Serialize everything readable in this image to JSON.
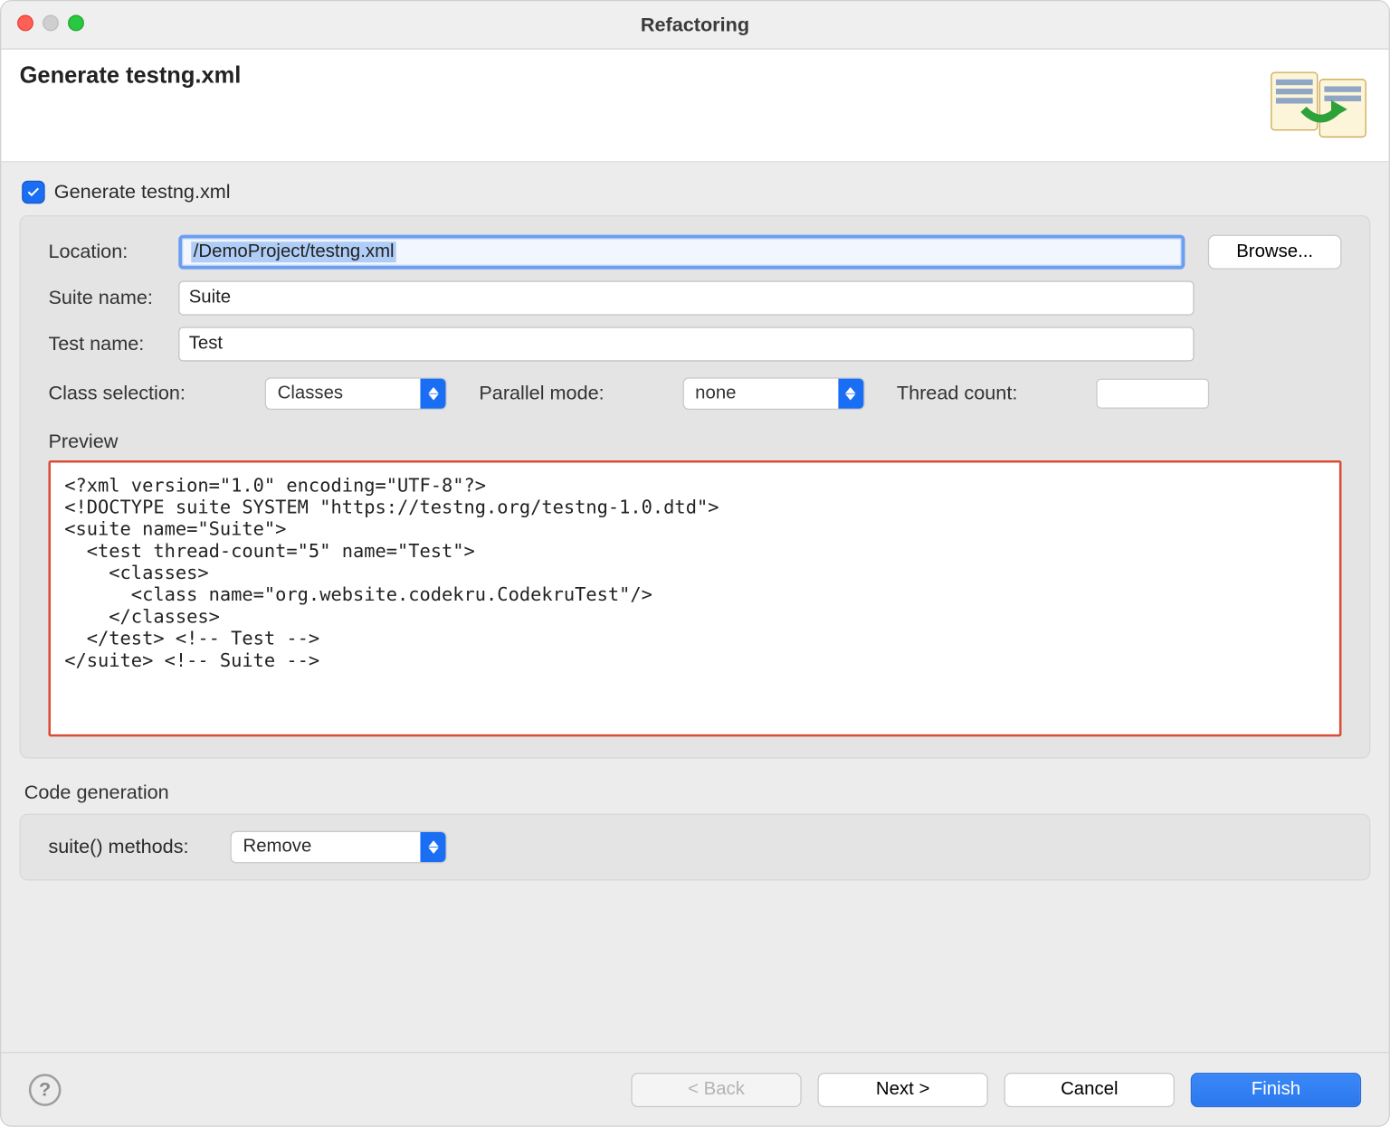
{
  "titlebar": {
    "title": "Refactoring"
  },
  "banner": {
    "heading": "Generate testng.xml"
  },
  "checkbox": {
    "label": "Generate testng.xml",
    "checked": true
  },
  "form": {
    "location_label": "Location:",
    "location_value": "/DemoProject/testng.xml",
    "browse_label": "Browse...",
    "suite_label": "Suite name:",
    "suite_value": "Suite",
    "test_label": "Test name:",
    "test_value": "Test",
    "class_selection_label": "Class selection:",
    "class_selection_value": "Classes",
    "parallel_label": "Parallel mode:",
    "parallel_value": "none",
    "thread_label": "Thread count:",
    "thread_value": "",
    "preview_label": "Preview",
    "preview_text": "<?xml version=\"1.0\" encoding=\"UTF-8\"?>\n<!DOCTYPE suite SYSTEM \"https://testng.org/testng-1.0.dtd\">\n<suite name=\"Suite\">\n  <test thread-count=\"5\" name=\"Test\">\n    <classes>\n      <class name=\"org.website.codekru.CodekruTest\"/>\n    </classes>\n  </test> <!-- Test -->\n</suite> <!-- Suite -->"
  },
  "codegen": {
    "section_label": "Code generation",
    "suite_methods_label": "suite() methods:",
    "suite_methods_value": "Remove"
  },
  "footer": {
    "back": "< Back",
    "next": "Next >",
    "cancel": "Cancel",
    "finish": "Finish"
  }
}
